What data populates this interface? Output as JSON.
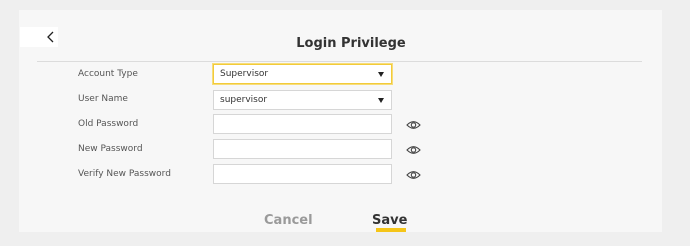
{
  "header": {
    "title": "Login Privilege",
    "back_icon": "chevron-left-icon"
  },
  "form": {
    "account_type": {
      "label": "Account Type",
      "value": "Supervisor",
      "control": "select"
    },
    "user_name": {
      "label": "User Name",
      "value": "supervisor",
      "control": "select"
    },
    "old_password": {
      "label": "Old Password",
      "value": "",
      "show_icon": "eye-icon"
    },
    "new_password": {
      "label": "New Password",
      "value": "",
      "show_icon": "eye-icon"
    },
    "verify_password": {
      "label": "Verify New Password",
      "value": "",
      "show_icon": "eye-icon"
    }
  },
  "actions": {
    "cancel_label": "Cancel",
    "save_label": "Save"
  },
  "colors": {
    "accent": "#f5c518",
    "focus_border": "#f2cb3a",
    "panel": "#f7f7f7",
    "background": "#efefef"
  }
}
